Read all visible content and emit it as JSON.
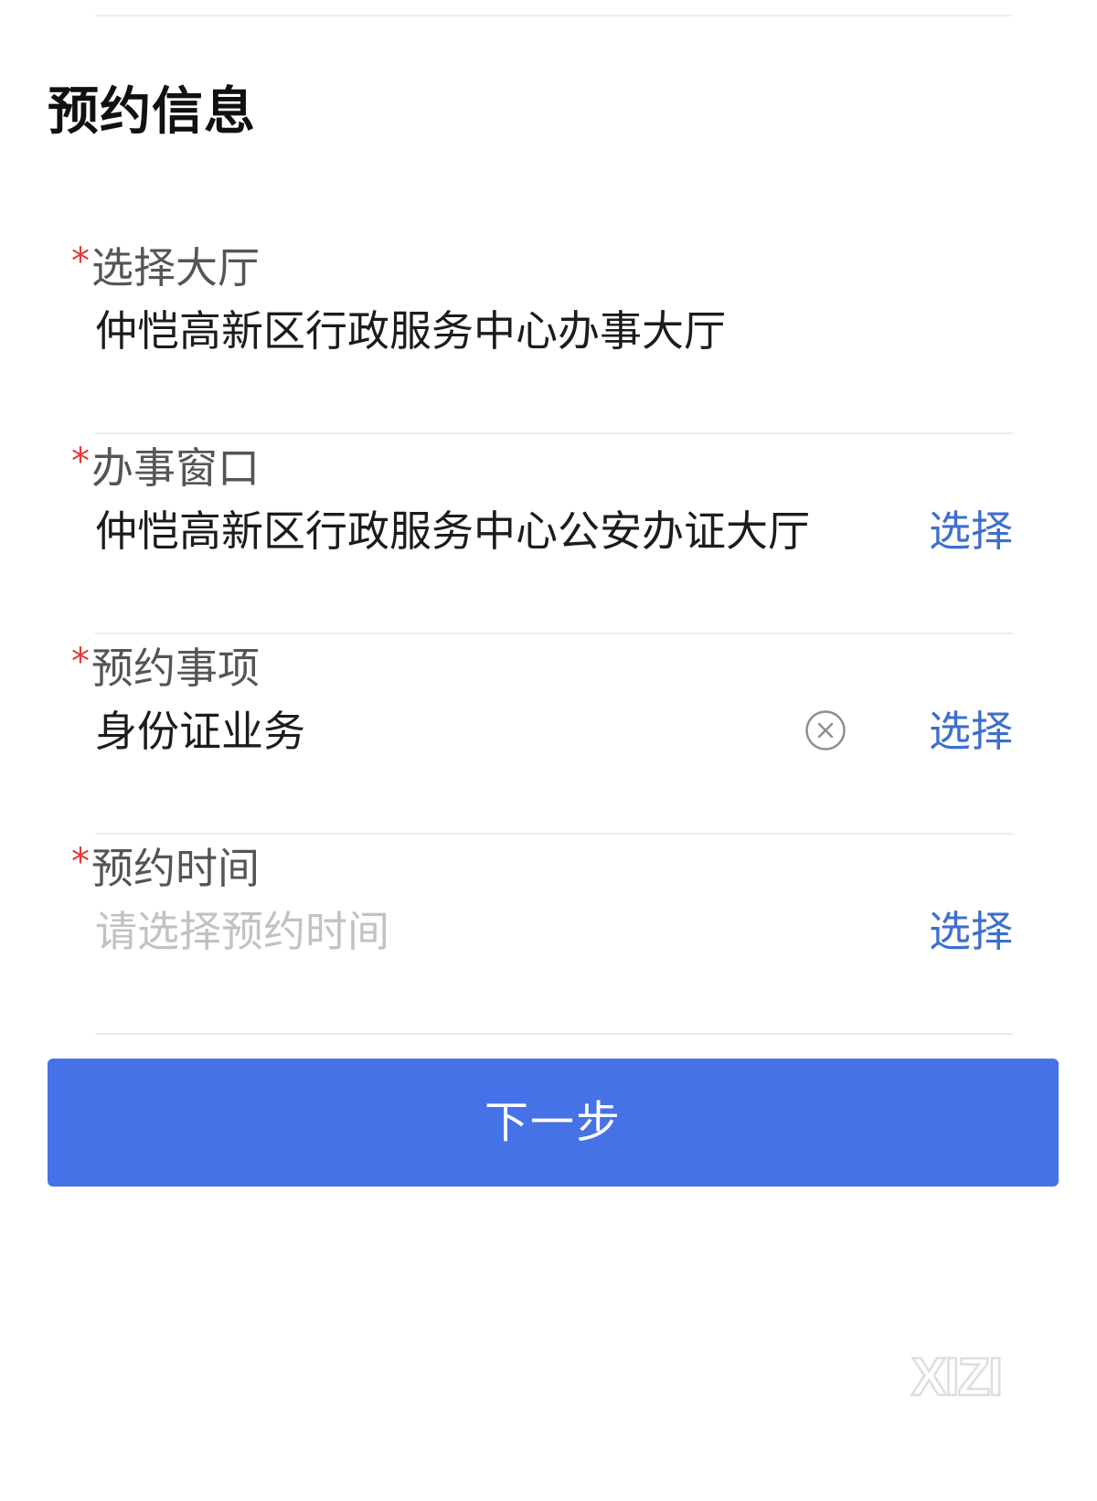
{
  "section": {
    "title": "预约信息"
  },
  "fields": [
    {
      "required_mark": "*",
      "label": "选择大厅",
      "value": "仲恺高新区行政服务中心办事大厅"
    },
    {
      "required_mark": "*",
      "label": "办事窗口",
      "value": "仲恺高新区行政服务中心公安办证大厅",
      "action_label": "选择"
    },
    {
      "required_mark": "*",
      "label": "预约事项",
      "value": "身份证业务",
      "clear_icon": "close-circle-icon",
      "action_label": "选择"
    },
    {
      "required_mark": "*",
      "label": "预约时间",
      "placeholder": "请选择预约时间",
      "action_label": "选择"
    }
  ],
  "buttons": {
    "next_label": "下一步"
  },
  "watermark": {
    "text": "XIZI"
  },
  "colors": {
    "primary": "#4672e8",
    "link": "#3e6fce",
    "required": "#e03a3a",
    "placeholder": "#c2c2c2",
    "divider": "#ececec"
  }
}
